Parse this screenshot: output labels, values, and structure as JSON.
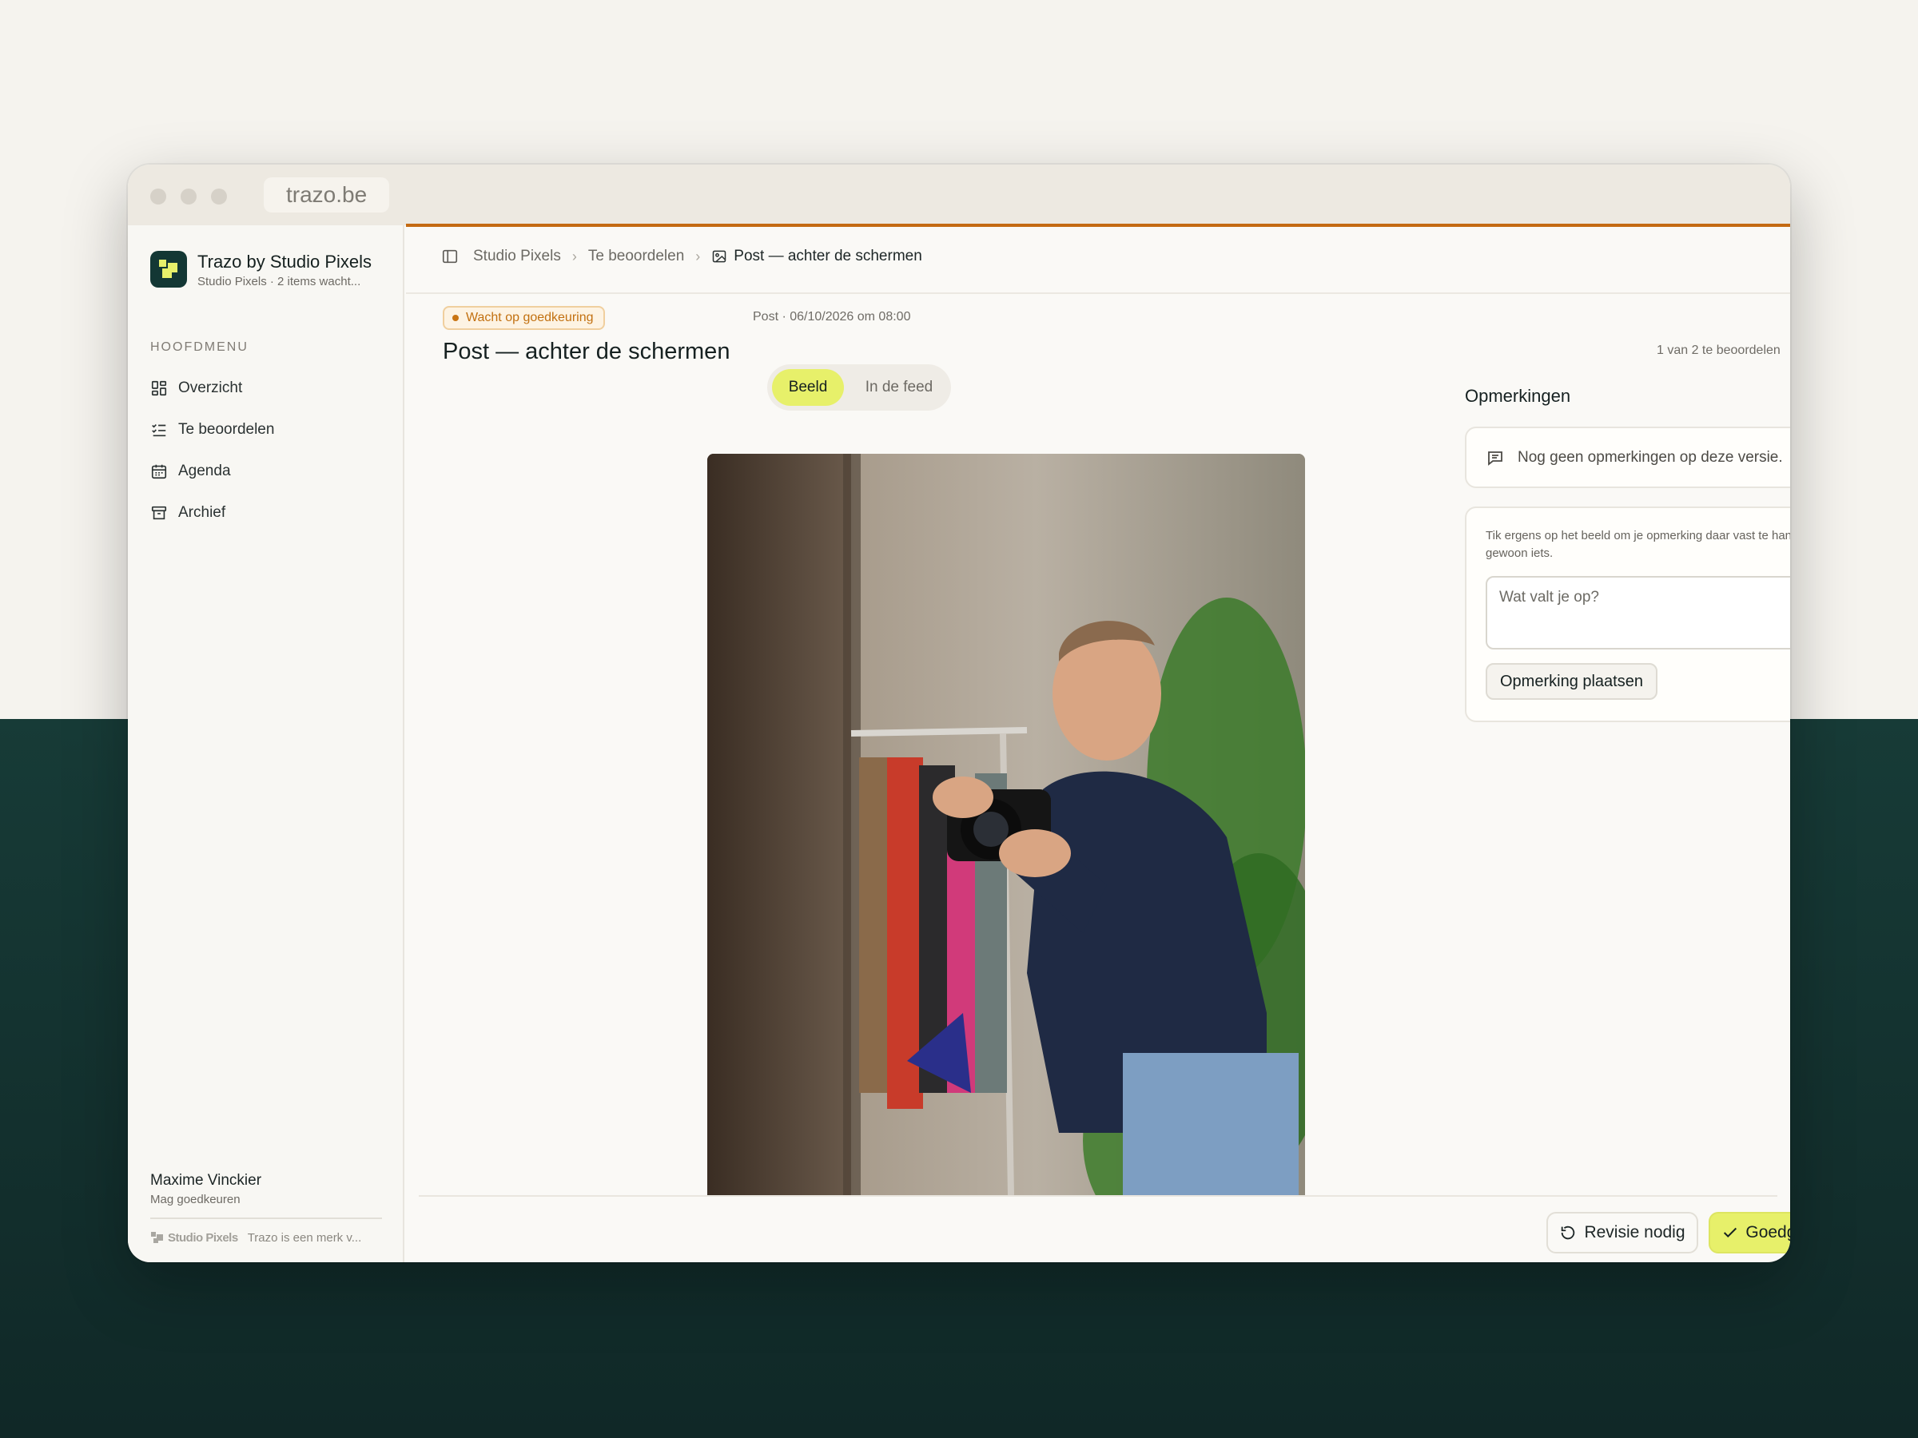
{
  "browser": {
    "url": "trazo.be"
  },
  "sidebar": {
    "brand_title": "Trazo by Studio Pixels",
    "brand_subtitle": "Studio Pixels · 2 items wacht...",
    "menu_heading": "HOOFDMENU",
    "items": [
      {
        "label": "Overzicht",
        "icon": "dashboard-icon",
        "active": true
      },
      {
        "label": "Te beoordelen",
        "icon": "checklist-icon"
      },
      {
        "label": "Agenda",
        "icon": "calendar-icon"
      },
      {
        "label": "Archief",
        "icon": "archive-icon"
      }
    ],
    "user": {
      "name": "Maxime Vinckier",
      "role": "Mag goedkeuren"
    },
    "footer": {
      "brand": "Studio Pixels",
      "note": "Trazo is een merk v..."
    }
  },
  "breadcrumb": {
    "items": [
      "Studio Pixels",
      "Te beoordelen",
      "Post — achter de schermen"
    ]
  },
  "post": {
    "status": "Wacht op goedkeuring",
    "meta": "Post · 06/10/2026 om 08:00",
    "title": "Post — achter de schermen",
    "counter": "1 van 2 te beoordelen"
  },
  "view_toggle": {
    "options": [
      "Beeld",
      "In de feed"
    ],
    "selected": "Beeld"
  },
  "comments": {
    "title": "Opmerkingen",
    "empty": "Nog geen opmerkingen op deze versie.",
    "hint": "Tik ergens op het beeld om je opmerking daar vast te hangen, of schrijf gewoon iets.",
    "placeholder": "Wat valt je op?",
    "submit": "Opmerking plaatsen"
  },
  "actions": {
    "revise": "Revisie nodig",
    "approve": "Goedgekeurd"
  },
  "colors": {
    "accent": "#e7f06a",
    "brand_dark": "#133734",
    "status": "#c27010",
    "topline": "#c46a12"
  }
}
